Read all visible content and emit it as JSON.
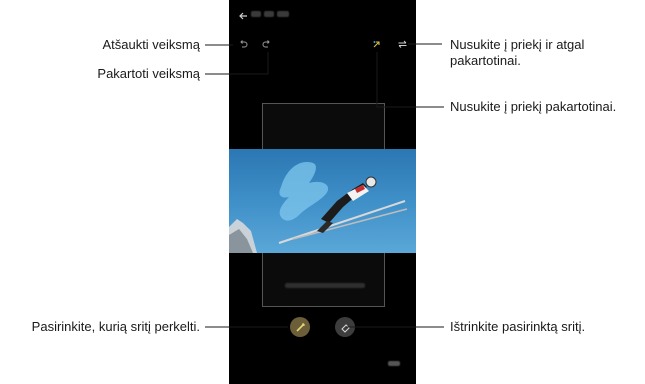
{
  "callouts": {
    "undo": "Atšaukti veiksmą",
    "redo": "Pakartoti veiksmą",
    "rewind_forward_line1": "Nusukite į priekį ir atgal",
    "rewind_forward_line2": "pakartotinai.",
    "forward": "Nusukite į priekį pakartotinai.",
    "select_area": "Pasirinkite, kurią sritį perkelti.",
    "erase_area": "Ištrinkite pasirinktą sritį."
  },
  "icons": {
    "back": "arrow-left-icon",
    "undo": "undo-icon",
    "redo": "redo-icon",
    "forward": "forward-repeat-icon",
    "loop": "loop-icon",
    "brush": "brush-icon",
    "eraser": "eraser-icon"
  },
  "colors": {
    "phone_bg": "#000000",
    "leader": "#1a1a1a",
    "brush_button": "#7a6a3a",
    "eraser_button": "#444444",
    "highlight": "#d4c24a"
  }
}
